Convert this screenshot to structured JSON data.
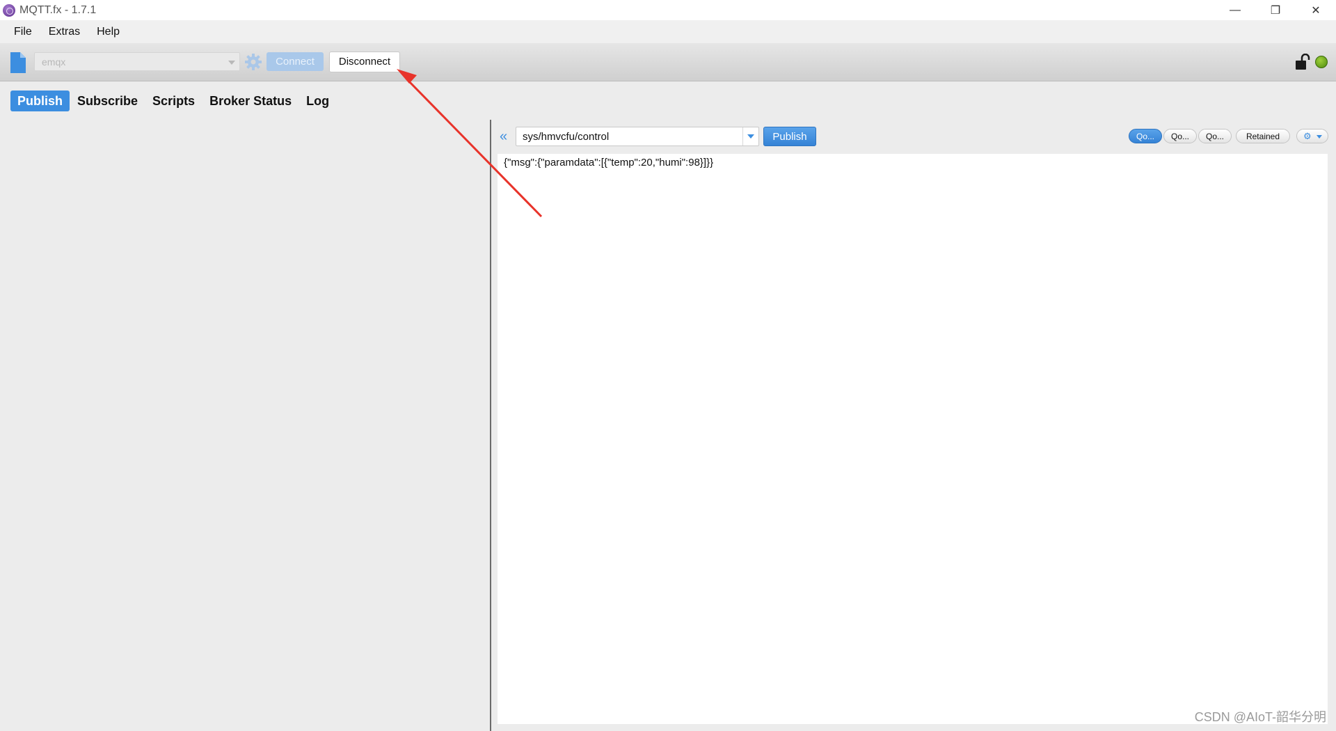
{
  "window": {
    "title": "MQTT.fx - 1.7.1"
  },
  "menu": {
    "items": [
      "File",
      "Extras",
      "Help"
    ]
  },
  "toolbar": {
    "profile": "emqx",
    "connect_label": "Connect",
    "disconnect_label": "Disconnect",
    "status_color": "#5a9a16"
  },
  "tabs": [
    "Publish",
    "Subscribe",
    "Scripts",
    "Broker Status",
    "Log"
  ],
  "publish": {
    "topic": "sys/hmvcfu/control",
    "publish_label": "Publish",
    "qos": [
      "Qo...",
      "Qo...",
      "Qo..."
    ],
    "retained_label": "Retained",
    "payload": "{\"msg\":{\"paramdata\":[{\"temp\":20,\"humi\":98}]}}"
  },
  "watermark": "CSDN @AIoT-韶华分明",
  "colors": {
    "accent": "#3c8ee0",
    "annotation_arrow": "#e8332a"
  }
}
